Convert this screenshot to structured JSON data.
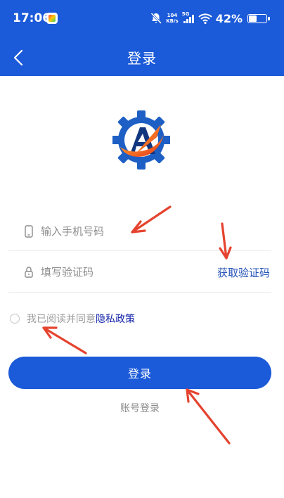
{
  "status_bar": {
    "time": "17:06",
    "net_speed_value": "104",
    "net_speed_unit": "KB/s",
    "signal_type": "5G",
    "battery_percent": "42%",
    "battery_level": 0.42
  },
  "nav": {
    "title": "登录",
    "back_icon": "chevron-left-icon"
  },
  "colors": {
    "primary": "#1b5ad8",
    "link": "#2554b8",
    "privacy_link": "#0e1ea8",
    "annotation_arrow": "#e5432f"
  },
  "logo": {
    "icon": "gear-a-logo"
  },
  "form": {
    "phone": {
      "icon": "phone-icon",
      "placeholder": "输入手机号码",
      "value": ""
    },
    "code": {
      "icon": "lock-icon",
      "placeholder": "填写验证码",
      "value": "",
      "get_code_label": "获取验证码"
    }
  },
  "agreement": {
    "checked": false,
    "text": "我已阅读并同意",
    "link_label": "隐私政策"
  },
  "login_button": {
    "label": "登录"
  },
  "account_login": {
    "label": "账号登录"
  }
}
